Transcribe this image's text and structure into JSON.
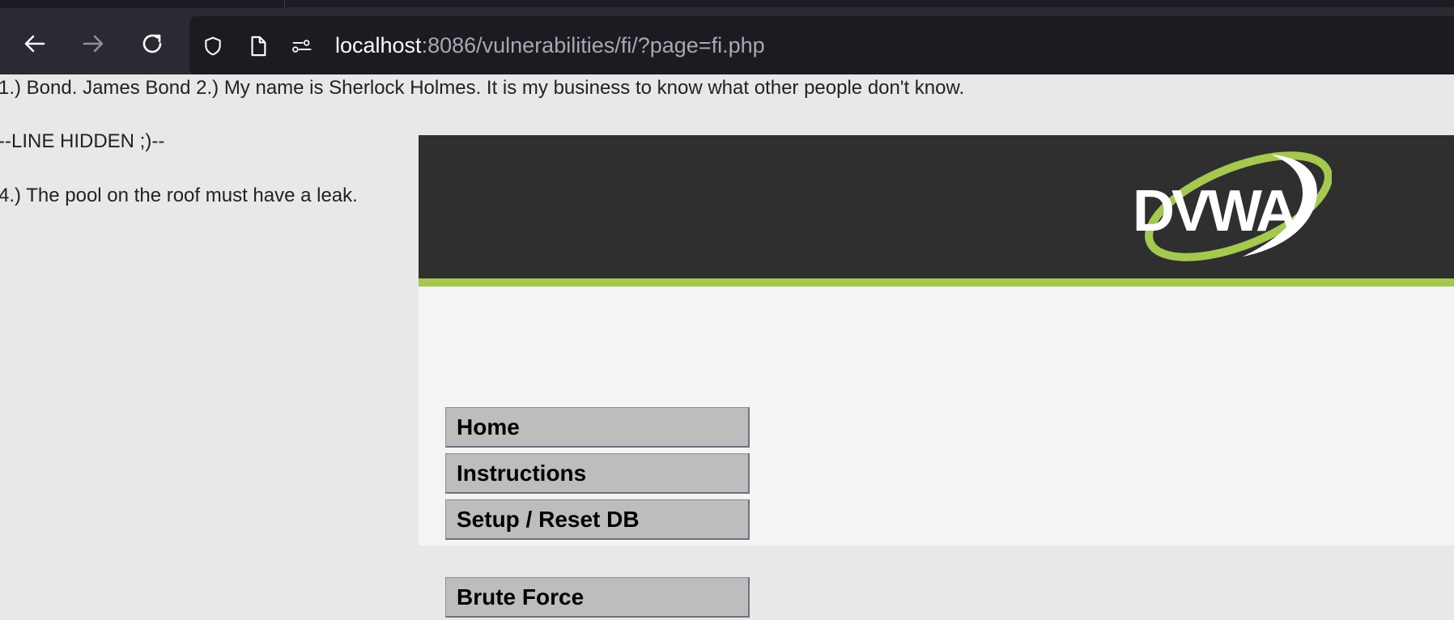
{
  "browser": {
    "url_host": "localhost",
    "url_rest": ":8086/vulnerabilities/fi/?page=fi.php",
    "icons": {
      "back": "back-arrow-icon",
      "forward": "forward-arrow-icon",
      "reload": "reload-icon",
      "shield": "shield-icon",
      "page": "page-icon",
      "permissions": "permissions-icon"
    }
  },
  "included_file": {
    "line1": "1.) Bond. James Bond 2.) My name is Sherlock Holmes. It is my business to know what other people don't know.",
    "line3": "--LINE HIDDEN ;)--",
    "line4": "4.) The pool on the roof must have a leak."
  },
  "dvwa": {
    "logo_text": "DVWA",
    "colors": {
      "header": "#2f2f2f",
      "accent": "#a5c84f",
      "menu_bg": "#bdbdbd",
      "body": "#f4f4f4"
    },
    "menu": [
      {
        "label": "Home"
      },
      {
        "label": "Instructions"
      },
      {
        "label": "Setup / Reset DB"
      },
      {
        "label": "Brute Force"
      }
    ]
  }
}
